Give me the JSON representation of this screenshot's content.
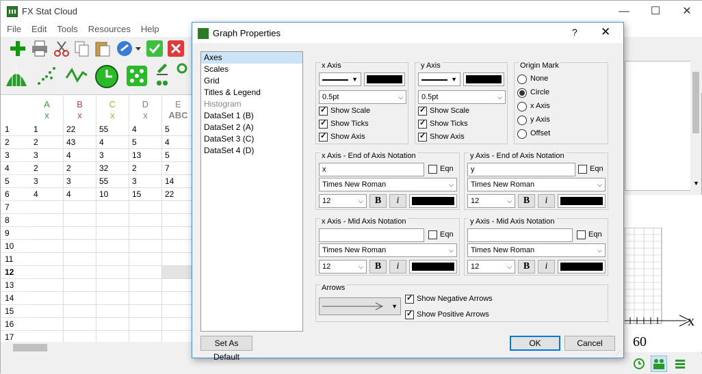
{
  "app": {
    "title": "FX Stat Cloud",
    "min": "—",
    "max": "☐",
    "close": "✕"
  },
  "menu": [
    "File",
    "Edit",
    "Tools",
    "Resources",
    "Help"
  ],
  "grid": {
    "columns": [
      {
        "letter": "A",
        "sub": "x"
      },
      {
        "letter": "B",
        "sub": "x"
      },
      {
        "letter": "C",
        "sub": "x"
      },
      {
        "letter": "D",
        "sub": "x"
      },
      {
        "letter": "E",
        "sub": "ABC"
      }
    ],
    "rows": [
      "1",
      "2",
      "3",
      "4",
      "5",
      "6",
      "7",
      "8",
      "9",
      "10",
      "11",
      "12",
      "13",
      "14",
      "15",
      "16",
      "17"
    ],
    "cells": [
      [
        "1",
        "22",
        "55",
        "4",
        "5"
      ],
      [
        "2",
        "43",
        "4",
        "5",
        "4"
      ],
      [
        "3",
        "4",
        "3",
        "13",
        "5"
      ],
      [
        "2",
        "2",
        "32",
        "2",
        "7"
      ],
      [
        "3",
        "3",
        "55",
        "3",
        "14"
      ],
      [
        "4",
        "4",
        "10",
        "15",
        "22"
      ]
    ]
  },
  "plot": {
    "axis_label": "x",
    "tick": "60"
  },
  "dialog": {
    "title": "Graph Properties",
    "help": "?",
    "close": "✕",
    "nav": [
      "Axes",
      "Scales",
      "Grid",
      "Titles & Legend",
      "Histogram",
      "DataSet 1 (B)",
      "DataSet 2 (A)",
      "DataSet 3 (C)",
      "DataSet 4 (D)"
    ],
    "x_axis": {
      "title": "x Axis",
      "width": "0.5pt",
      "show_scale": "Show Scale",
      "show_ticks": "Show Ticks",
      "show_axis": "Show Axis"
    },
    "y_axis": {
      "title": "y Axis",
      "width": "0.5pt",
      "show_scale": "Show Scale",
      "show_ticks": "Show Ticks",
      "show_axis": "Show Axis"
    },
    "origin": {
      "title": "Origin Mark",
      "options": [
        "None",
        "Circle",
        "x Axis",
        "y Axis",
        "Offset"
      ],
      "selected": "Circle"
    },
    "x_end": {
      "title": "x Axis - End of Axis Notation",
      "value": "x",
      "eqn": "Eqn",
      "font": "Times New Roman",
      "size": "12",
      "bold": "B",
      "italic": "i"
    },
    "y_end": {
      "title": "y Axis - End of Axis Notation",
      "value": "y",
      "eqn": "Eqn",
      "font": "Times New Roman",
      "size": "12",
      "bold": "B",
      "italic": "i"
    },
    "x_mid": {
      "title": "x Axis - Mid Axis Notation",
      "value": "",
      "eqn": "Eqn",
      "font": "Times New Roman",
      "size": "12",
      "bold": "B",
      "italic": "i"
    },
    "y_mid": {
      "title": "y Axis - Mid Axis Notation",
      "value": "",
      "eqn": "Eqn",
      "font": "Times New Roman",
      "size": "12",
      "bold": "B",
      "italic": "i"
    },
    "arrows": {
      "title": "Arrows",
      "negative": "Show Negative Arrows",
      "positive": "Show Positive Arrows"
    },
    "set_default": "Set As Default",
    "ok": "OK",
    "cancel": "Cancel"
  }
}
